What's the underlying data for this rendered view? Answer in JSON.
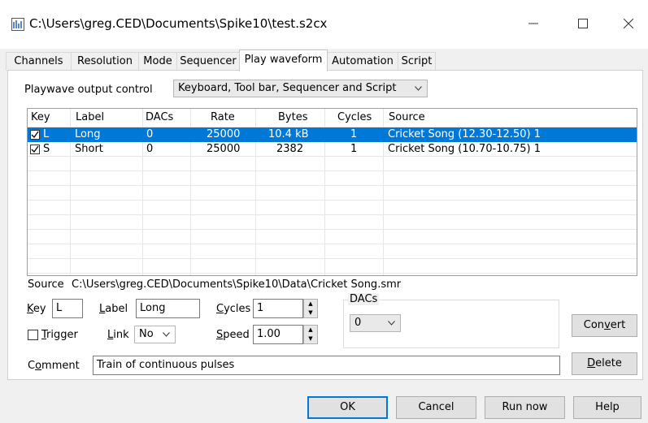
{
  "window": {
    "title": "C:\\Users\\greg.CED\\Documents\\Spike10\\test.s2cx",
    "minimize": "—",
    "close": "✕"
  },
  "tabs": [
    "Channels",
    "Resolution",
    "Mode",
    "Sequencer",
    "Play waveform",
    "Automation",
    "Script"
  ],
  "active_tab": "Play waveform",
  "output_control": {
    "label": "Playwave output control",
    "value": "Keyboard, Tool bar, Sequencer and Script"
  },
  "table": {
    "columns": [
      "Key",
      "Label",
      "DACs",
      "Rate",
      "Bytes",
      "Cycles",
      "Source"
    ],
    "rows": [
      {
        "checked": true,
        "key": "L",
        "label": "Long",
        "dacs": "0",
        "rate": "25000",
        "bytes": "10.4 kB",
        "cycles": "1",
        "source": "Cricket Song (12.30-12.50) 1",
        "selected": true
      },
      {
        "checked": true,
        "key": "S",
        "label": "Short",
        "dacs": "0",
        "rate": "25000",
        "bytes": "2382",
        "cycles": "1",
        "source": "Cricket Song (10.70-10.75) 1",
        "selected": false
      }
    ]
  },
  "source": {
    "label": "Source",
    "path": "C:\\Users\\greg.CED\\Documents\\Spike10\\Data\\Cricket Song.smr"
  },
  "fields": {
    "key_label": "Key",
    "key_value": "L",
    "label_label": "Label",
    "label_value": "Long",
    "cycles_label": "Cycles",
    "cycles_value": "1",
    "trigger_label": "Trigger",
    "link_label": "Link",
    "link_value": "No",
    "speed_label": "Speed",
    "speed_value": "1.00",
    "dacs_group_label": "DACs",
    "dacs_value": "0",
    "comment_label": "Comment",
    "comment_value": "Train of continuous pulses"
  },
  "buttons": {
    "convert": "Convert",
    "delete": "Delete",
    "ok": "OK",
    "cancel": "Cancel",
    "run_now": "Run now",
    "help": "Help"
  },
  "colors": {
    "selection": "#0078d7",
    "default_button_border": "#0078d7"
  }
}
